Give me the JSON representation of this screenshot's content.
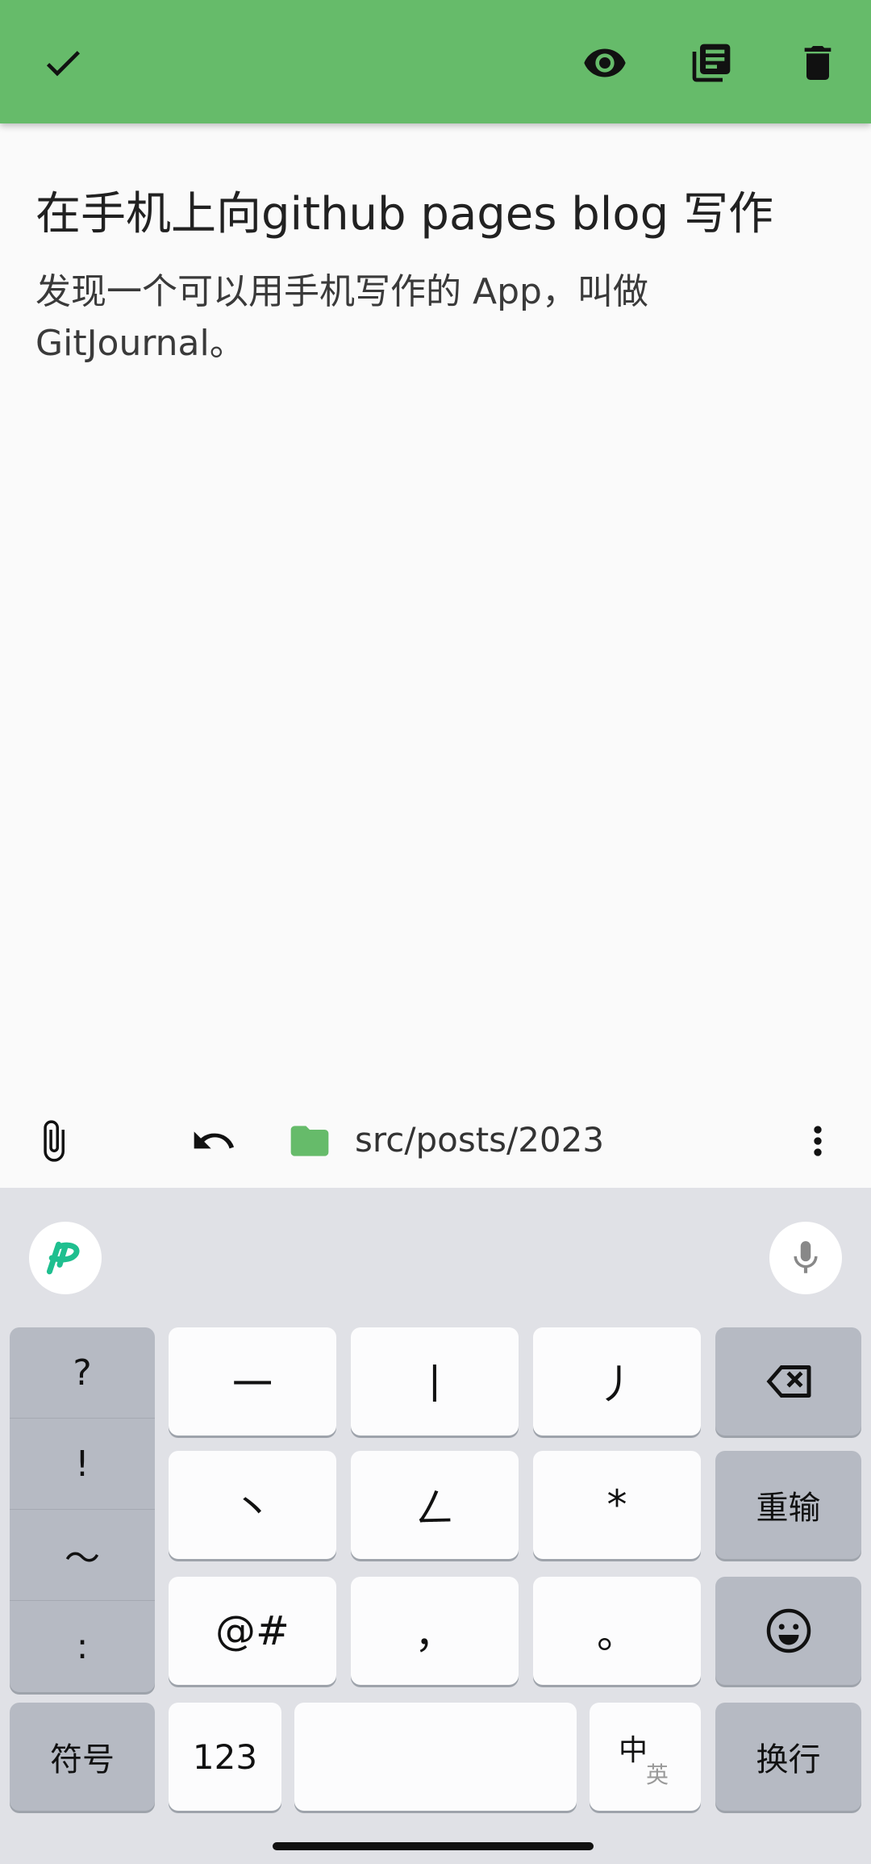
{
  "appbar": {
    "bg_color": "#66bb6a",
    "icons": [
      "check-icon",
      "eye-icon",
      "library-books-icon",
      "trash-icon"
    ]
  },
  "note": {
    "title": "在手机上向github pages blog 写作",
    "body_line1": "发现一个可以用手机写作的 App，叫做",
    "body_line2": "GitJournal。"
  },
  "toolbar": {
    "folder_path": "src/posts/2023",
    "folder_color": "#66bb6a"
  },
  "keyboard": {
    "symbols_column": [
      "?",
      "!",
      "～",
      ":"
    ],
    "row1": [
      "一",
      "丨",
      "丿"
    ],
    "row2": [
      "丶",
      "ㄥ",
      "*"
    ],
    "row3": [
      "@#",
      "，",
      "。"
    ],
    "reenter_label": "重输",
    "symbol_label": "符号",
    "num_label": "123",
    "lang_main": "中",
    "lang_sub": "英",
    "enter_label": "换行"
  }
}
